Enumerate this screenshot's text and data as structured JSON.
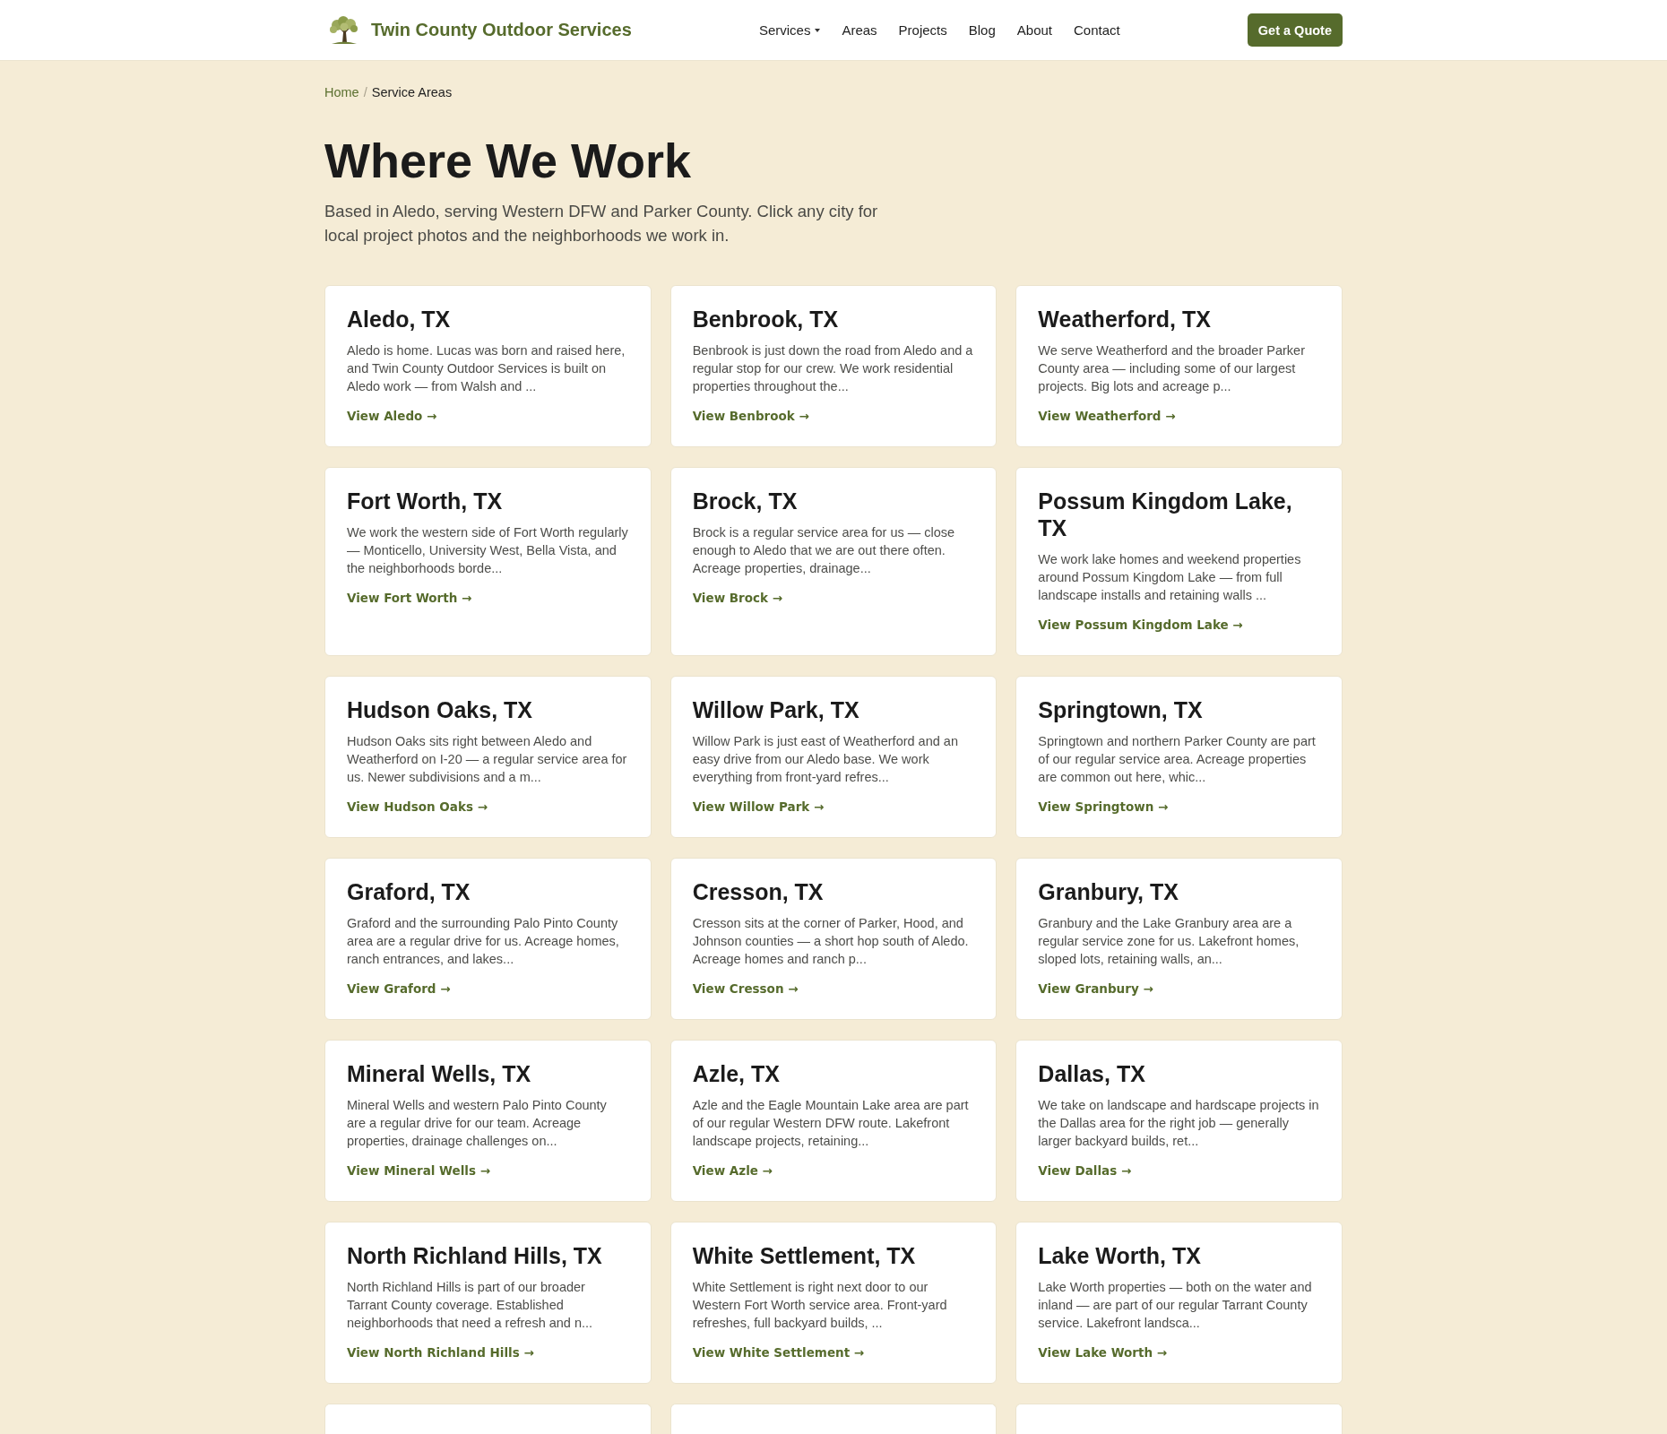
{
  "header": {
    "brand": {
      "name": "Twin County Outdoor Services"
    },
    "nav": [
      {
        "label": "Services",
        "has_menu": true
      },
      {
        "label": "Areas",
        "has_menu": false
      },
      {
        "label": "Projects",
        "has_menu": false
      },
      {
        "label": "Blog",
        "has_menu": false
      },
      {
        "label": "About",
        "has_menu": false
      },
      {
        "label": "Contact",
        "has_menu": false
      }
    ],
    "cta": {
      "label": "Get a Quote"
    }
  },
  "breadcrumb": {
    "separator": "/",
    "items": [
      {
        "kind": "link",
        "label": "Home"
      },
      {
        "kind": "current",
        "label": "Service Areas"
      }
    ]
  },
  "hero": {
    "title": "Where We Work",
    "lead": "Based in Aledo, serving Western DFW and Parker County. Click any city for local project photos and the neighborhoods we work in."
  },
  "areas": [
    {
      "kind": "card",
      "title": "Aledo, TX",
      "excerpt": "Aledo is home. Lucas was born and raised here, and Twin County Outdoor Services is built on Aledo work — from Walsh and ...",
      "link": "View Aledo →"
    },
    {
      "kind": "card",
      "title": "Benbrook, TX",
      "excerpt": "Benbrook is just down the road from Aledo and a regular stop for our crew. We work residential properties throughout the...",
      "link": "View Benbrook →"
    },
    {
      "kind": "card",
      "title": "Weatherford, TX",
      "excerpt": "We serve Weatherford and the broader Parker County area — including some of our largest projects. Big lots and acreage p...",
      "link": "View Weatherford →"
    },
    {
      "kind": "card",
      "title": "Fort Worth, TX",
      "excerpt": "We work the western side of Fort Worth regularly — Monticello, University West, Bella Vista, and the neighborhoods borde...",
      "link": "View Fort Worth →"
    },
    {
      "kind": "card",
      "title": "Brock, TX",
      "excerpt": "Brock is a regular service area for us — close enough to Aledo that we are out there often. Acreage properties, drainage...",
      "link": "View Brock →"
    },
    {
      "kind": "card",
      "title": "Possum Kingdom Lake, TX",
      "excerpt": "We work lake homes and weekend properties around Possum Kingdom Lake — from full landscape installs and retaining walls ...",
      "link": "View Possum Kingdom Lake →"
    },
    {
      "kind": "card",
      "title": "Hudson Oaks, TX",
      "excerpt": "Hudson Oaks sits right between Aledo and Weatherford on I-20 — a regular service area for us. Newer subdivisions and a m...",
      "link": "View Hudson Oaks →"
    },
    {
      "kind": "card",
      "title": "Willow Park, TX",
      "excerpt": "Willow Park is just east of Weatherford and an easy drive from our Aledo base. We work everything from front-yard refres...",
      "link": "View Willow Park →"
    },
    {
      "kind": "card",
      "title": "Springtown, TX",
      "excerpt": "Springtown and northern Parker County are part of our regular service area. Acreage properties are common out here, whic...",
      "link": "View Springtown →"
    },
    {
      "kind": "card",
      "title": "Graford, TX",
      "excerpt": "Graford and the surrounding Palo Pinto County area are a regular drive for us. Acreage homes, ranch entrances, and lakes...",
      "link": "View Graford →"
    },
    {
      "kind": "card",
      "title": "Cresson, TX",
      "excerpt": "Cresson sits at the corner of Parker, Hood, and Johnson counties — a short hop south of Aledo. Acreage homes and ranch p...",
      "link": "View Cresson →"
    },
    {
      "kind": "card",
      "title": "Granbury, TX",
      "excerpt": "Granbury and the Lake Granbury area are a regular service zone for us. Lakefront homes, sloped lots, retaining walls, an...",
      "link": "View Granbury →"
    },
    {
      "kind": "card",
      "title": "Mineral Wells, TX",
      "excerpt": "Mineral Wells and western Palo Pinto County are a regular drive for our team. Acreage properties, drainage challenges on...",
      "link": "View Mineral Wells →"
    },
    {
      "kind": "card",
      "title": "Azle, TX",
      "excerpt": "Azle and the Eagle Mountain Lake area are part of our regular Western DFW route. Lakefront landscape projects, retaining...",
      "link": "View Azle →"
    },
    {
      "kind": "card",
      "title": "Dallas, TX",
      "excerpt": "We take on landscape and hardscape projects in the Dallas area for the right job — generally larger backyard builds, ret...",
      "link": "View Dallas →"
    },
    {
      "kind": "card",
      "title": "North Richland Hills, TX",
      "excerpt": "North Richland Hills is part of our broader Tarrant County coverage. Established neighborhoods that need a refresh and n...",
      "link": "View North Richland Hills →"
    },
    {
      "kind": "card",
      "title": "White Settlement, TX",
      "excerpt": "White Settlement is right next door to our Western Fort Worth service area. Front-yard refreshes, full backyard builds, ...",
      "link": "View White Settlement →"
    },
    {
      "kind": "card",
      "title": "Lake Worth, TX",
      "excerpt": "Lake Worth properties — both on the water and inland — are part of our regular Tarrant County service. Lakefront landsca...",
      "link": "View Lake Worth →"
    },
    {
      "kind": "cut_off"
    },
    {
      "kind": "cut_off"
    },
    {
      "kind": "cut_off"
    }
  ]
}
